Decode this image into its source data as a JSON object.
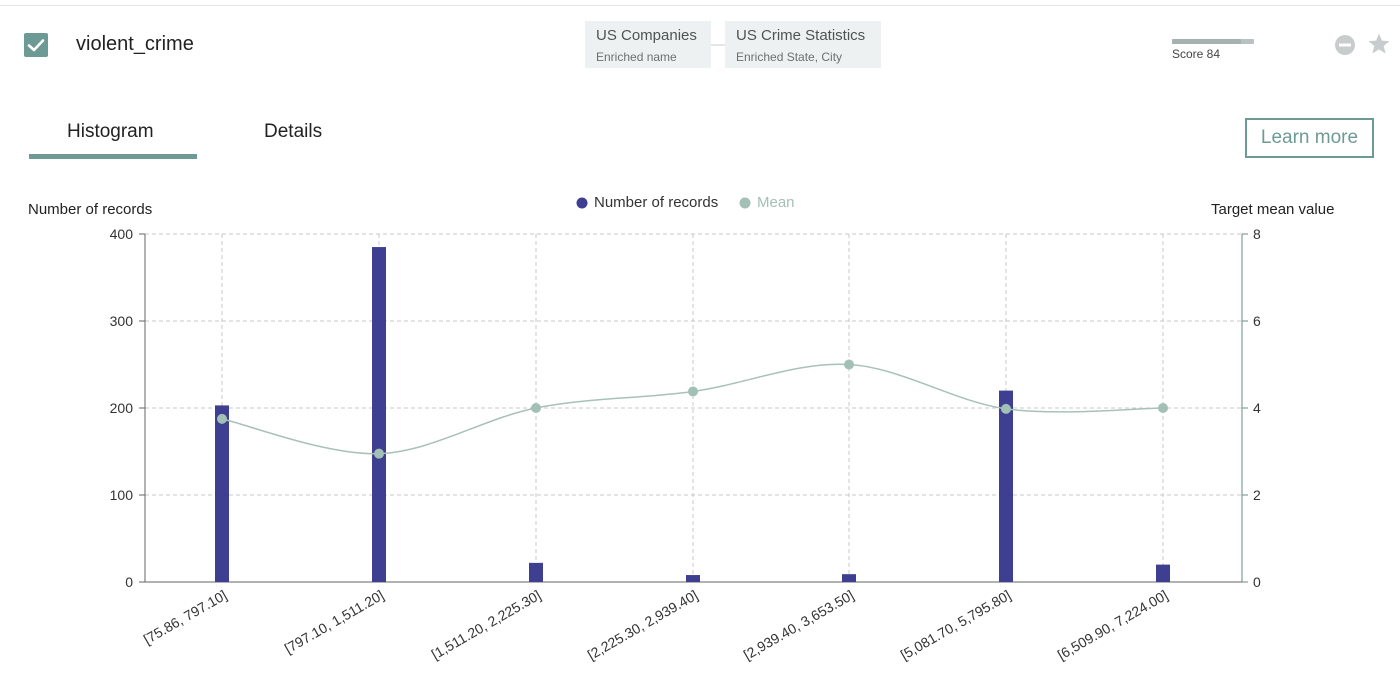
{
  "feature": {
    "name": "violent_crime",
    "checked": true
  },
  "sources": [
    {
      "title": "US Companies",
      "subtitle": "Enriched name"
    },
    {
      "title": "US Crime Statistics",
      "subtitle": "Enriched State, City"
    }
  ],
  "score": {
    "label": "Score 84",
    "value": 84
  },
  "tabs": [
    {
      "label": "Histogram",
      "active": true
    },
    {
      "label": "Details",
      "active": false
    }
  ],
  "learn_more_label": "Learn more",
  "icons": {
    "checkbox": "check-icon",
    "remove": "remove-icon",
    "favorite": "star-icon"
  },
  "colors": {
    "bars": "#3f3f91",
    "mean": "#a3c0b6",
    "mean_line": "#a8c1bb",
    "accent": "#6e9a96"
  },
  "chart_data": {
    "type": "bar",
    "categories": [
      "[75.86, 797.10]",
      "[797.10, 1,511.20]",
      "[1,511.20, 2,225.30]",
      "[2,225.30, 2,939.40]",
      "[2,939.40, 3,653.50]",
      "[5,081.70, 5,795.80]",
      "[6,509.90, 7,224.00]"
    ],
    "series": [
      {
        "name": "Number of records",
        "type": "bar",
        "axis": "left",
        "values": [
          203,
          385,
          22,
          8,
          9,
          220,
          20
        ]
      },
      {
        "name": "Mean",
        "type": "line",
        "axis": "right",
        "values": [
          3.75,
          2.95,
          4.0,
          4.38,
          5.0,
          3.98,
          4.0
        ]
      }
    ],
    "ylabel": "Number of records",
    "y2label": "Target mean value",
    "ylim": [
      0,
      400
    ],
    "yticks": [
      0,
      100,
      200,
      300,
      400
    ],
    "y2lim": [
      0,
      8
    ],
    "y2ticks": [
      0,
      2,
      4,
      6,
      8
    ],
    "grid": true,
    "legend_position": "top-center"
  }
}
